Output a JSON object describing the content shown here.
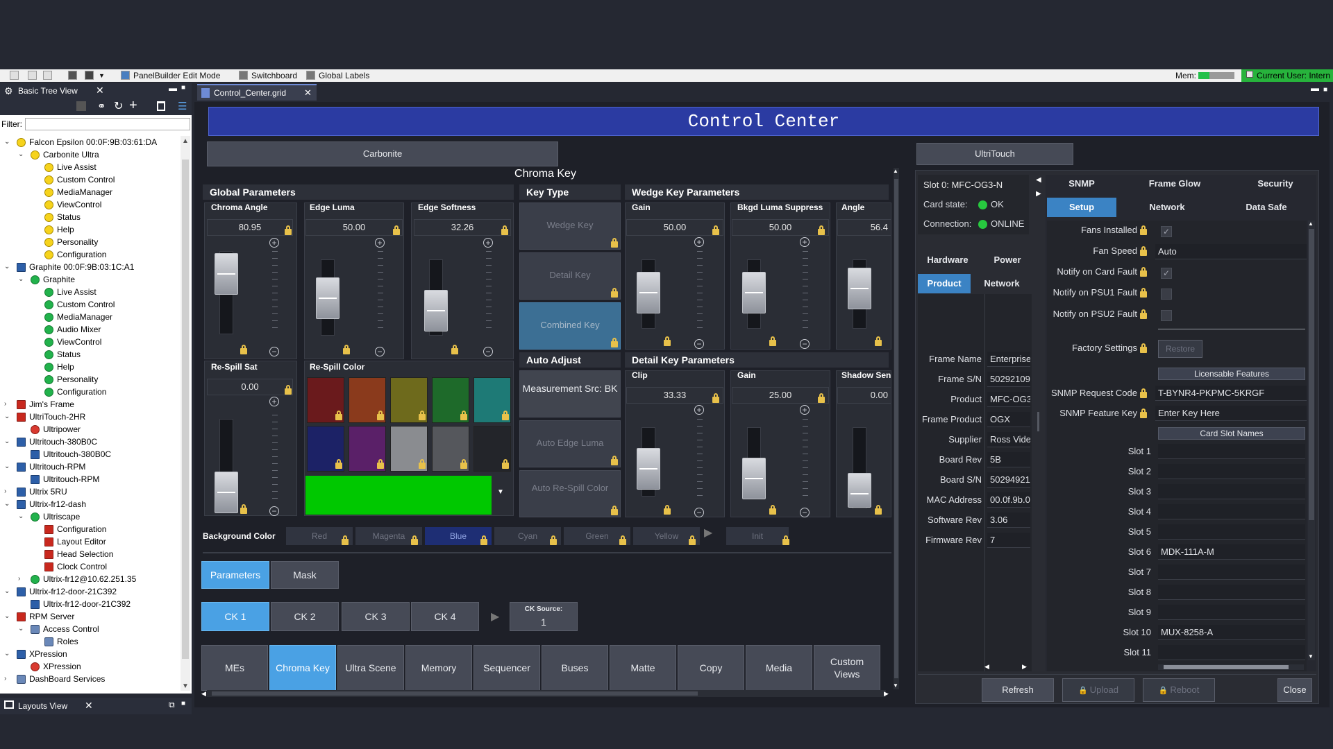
{
  "toolbar": {
    "panelbuilder": "PanelBuilder Edit Mode",
    "switchboard": "Switchboard",
    "global_labels": "Global Labels",
    "mem_label": "Mem:",
    "current_user": "Current User: Intern"
  },
  "tree": {
    "title": "Basic Tree View",
    "filter_label": "Filter:",
    "items": [
      {
        "label": "Falcon Epsilon  00:0F:9B:03:61:DA"
      },
      {
        "label": "Carbonite Ultra"
      },
      {
        "label": "Live Assist"
      },
      {
        "label": "Custom Control"
      },
      {
        "label": "MediaManager"
      },
      {
        "label": "ViewControl"
      },
      {
        "label": "Status"
      },
      {
        "label": "Help"
      },
      {
        "label": "Personality"
      },
      {
        "label": "Configuration"
      },
      {
        "label": "Graphite 00:0F:9B:03:1C:A1"
      },
      {
        "label": "Graphite"
      },
      {
        "label": "Live Assist"
      },
      {
        "label": "Custom Control"
      },
      {
        "label": "MediaManager"
      },
      {
        "label": "Audio Mixer"
      },
      {
        "label": "ViewControl"
      },
      {
        "label": "Status"
      },
      {
        "label": "Help"
      },
      {
        "label": "Personality"
      },
      {
        "label": "Configuration"
      },
      {
        "label": "Jim's Frame"
      },
      {
        "label": "UltriTouch-2HR"
      },
      {
        "label": "Ultripower"
      },
      {
        "label": "Ultritouch-380B0C"
      },
      {
        "label": "Ultritouch-380B0C"
      },
      {
        "label": "Ultritouch-RPM"
      },
      {
        "label": "Ultritouch-RPM"
      },
      {
        "label": "Ultrix 5RU"
      },
      {
        "label": "Ultrix-fr12-dash"
      },
      {
        "label": "Ultriscape"
      },
      {
        "label": "Configuration"
      },
      {
        "label": "Layout Editor"
      },
      {
        "label": "Head Selection"
      },
      {
        "label": "Clock Control"
      },
      {
        "label": "Ultrix-fr12@10.62.251.35"
      },
      {
        "label": "Ultrix-fr12-door-21C392"
      },
      {
        "label": "Ultrix-fr12-door-21C392"
      },
      {
        "label": "RPM Server"
      },
      {
        "label": "Access Control"
      },
      {
        "label": "Roles"
      },
      {
        "label": "XPression"
      },
      {
        "label": "XPression"
      },
      {
        "label": "DashBoard Services"
      }
    ],
    "layouts_title": "Layouts View"
  },
  "doc_tab": "Control_Center.grid",
  "page_title": "Control Center",
  "carbonite_btn": "Carbonite",
  "ultritouch_btn": "UltriTouch",
  "chroma_key_title": "Chroma Key",
  "global": {
    "title": "Global Parameters",
    "chroma_angle": {
      "label": "Chroma Angle",
      "value": "80.95",
      "level": 0.5
    },
    "edge_luma": {
      "label": "Edge Luma",
      "value": "50.00",
      "level": 0.5
    },
    "edge_softness": {
      "label": "Edge Softness",
      "value": "32.26",
      "level": 0.32
    },
    "respill_sat": {
      "label": "Re-Spill Sat",
      "value": "0.00",
      "level": 0.0
    },
    "respill_color": {
      "label": "Re-Spill Color"
    }
  },
  "swatch_colors": [
    "#6a1a1c",
    "#8a3a1c",
    "#6e6a1c",
    "#1e6a2a",
    "#1e7a76",
    "#1c2266",
    "#5a2068",
    "#8a8c90",
    "#55575c",
    "#23252a"
  ],
  "respill_color_value": "#00c800",
  "key_type": {
    "title": "Key Type",
    "wedge": "Wedge Key",
    "detail": "Detail Key",
    "combined": "Combined Key"
  },
  "auto_adjust": {
    "title": "Auto Adjust",
    "measure": "Measurement Src: BK",
    "edge_luma": "Auto Edge Luma",
    "respill": "Auto Re-Spill Color"
  },
  "wedge": {
    "title": "Wedge Key Parameters",
    "gain": {
      "label": "Gain",
      "value": "50.00"
    },
    "bkgd": {
      "label": "Bkgd Luma Suppress",
      "value": "50.00"
    },
    "angle": {
      "label": "Angle",
      "value": "56.4"
    }
  },
  "detail": {
    "title": "Detail Key Parameters",
    "clip": {
      "label": "Clip",
      "value": "33.33"
    },
    "gain": {
      "label": "Gain",
      "value": "25.00"
    },
    "shadow": {
      "label": "Shadow Sen",
      "value": "0.00"
    }
  },
  "bg_color": {
    "label": "Background Color",
    "options": [
      "Red",
      "Magenta",
      "Blue",
      "Cyan",
      "Green",
      "Yellow"
    ],
    "init": "Init"
  },
  "tabs": {
    "parameters": "Parameters",
    "mask": "Mask"
  },
  "ck": {
    "ck1": "CK 1",
    "ck2": "CK 2",
    "ck3": "CK 3",
    "ck4": "CK 4",
    "source_label": "CK Source:",
    "source_value": "1"
  },
  "bottom_tabs": [
    {
      "label": "MEs"
    },
    {
      "label": "Chroma Key"
    },
    {
      "label": "Ultra Scene"
    },
    {
      "label": "Memory"
    },
    {
      "label": "Sequencer"
    },
    {
      "label": "Buses"
    },
    {
      "label": "Matte"
    },
    {
      "label": "Copy"
    },
    {
      "label": "Media"
    },
    {
      "label": "Custom Views"
    }
  ],
  "card": {
    "slot": "Slot 0: MFC-OG3-N",
    "state_label": "Card state:",
    "state_value": "OK",
    "conn_label": "Connection:",
    "conn_value": "ONLINE",
    "tabs": {
      "hardware": "Hardware",
      "power": "Power",
      "product": "Product",
      "network": "Network"
    },
    "fields": [
      {
        "label": "Frame Name",
        "value": "Enterprise"
      },
      {
        "label": "Frame S/N",
        "value": "50292109"
      },
      {
        "label": "Product",
        "value": "MFC-OG3"
      },
      {
        "label": "Frame Product",
        "value": "OGX"
      },
      {
        "label": "Supplier",
        "value": "Ross Vide"
      },
      {
        "label": "Board Rev",
        "value": "5B"
      },
      {
        "label": "Board S/N",
        "value": "50294921"
      },
      {
        "label": "MAC Address",
        "value": "00.0f.9b.0"
      },
      {
        "label": "Software Rev",
        "value": "3.06"
      },
      {
        "label": "Firmware Rev",
        "value": "7"
      }
    ]
  },
  "settings": {
    "tabs_top": {
      "snmp": "SNMP",
      "frame_glow": "Frame Glow",
      "security": "Security"
    },
    "tabs_bot": {
      "setup": "Setup",
      "network": "Network",
      "data_safe": "Data Safe"
    },
    "fans_installed": "Fans Installed",
    "fan_speed": {
      "label": "Fan Speed",
      "value": "Auto"
    },
    "notify_card": "Notify on Card Fault",
    "notify_psu1": "Notify on PSU1 Fault",
    "notify_psu2": "Notify on PSU2 Fault",
    "factory": {
      "label": "Factory Settings",
      "button": "Restore"
    },
    "licensable": "Licensable Features",
    "snmp_req": {
      "label": "SNMP Request Code",
      "value": "T-BYNR4-PKPMC-5KRGF"
    },
    "snmp_key": {
      "label": "SNMP Feature Key",
      "value": "Enter Key Here"
    },
    "card_slot_names": "Card Slot Names",
    "slots": [
      {
        "label": "Slot 1",
        "value": ""
      },
      {
        "label": "Slot 2",
        "value": ""
      },
      {
        "label": "Slot 3",
        "value": ""
      },
      {
        "label": "Slot 4",
        "value": ""
      },
      {
        "label": "Slot 5",
        "value": ""
      },
      {
        "label": "Slot 6",
        "value": "MDK-111A-M"
      },
      {
        "label": "Slot 7",
        "value": ""
      },
      {
        "label": "Slot 8",
        "value": ""
      },
      {
        "label": "Slot 9",
        "value": ""
      },
      {
        "label": "Slot 10",
        "value": "MUX-8258-A"
      },
      {
        "label": "Slot 11",
        "value": ""
      }
    ]
  },
  "footer": {
    "refresh": "Refresh",
    "upload": "Upload",
    "reboot": "Reboot",
    "close": "Close"
  }
}
